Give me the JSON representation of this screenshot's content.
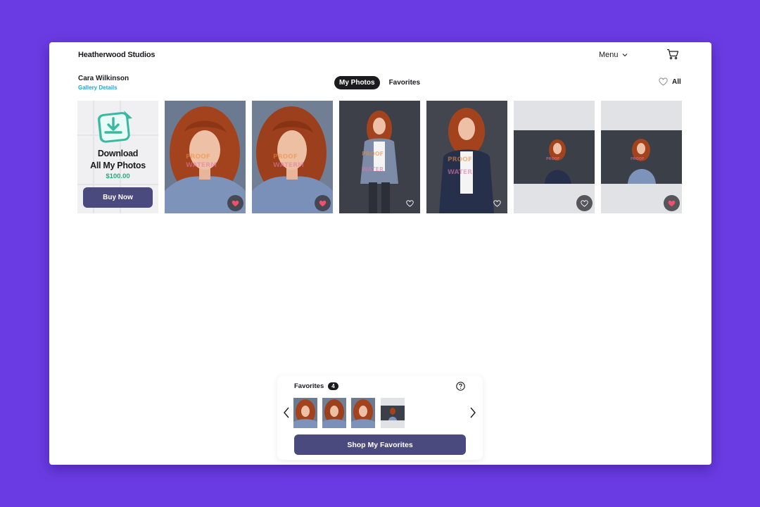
{
  "header": {
    "brand": "Heatherwood Studios",
    "menu_label": "Menu",
    "cart_icon": "cart-icon"
  },
  "subheader": {
    "user_name": "Cara Wilkinson",
    "gallery_link": "Gallery Details"
  },
  "tabs": [
    {
      "label": "My Photos",
      "active": true
    },
    {
      "label": "Favorites",
      "active": false
    }
  ],
  "filter": {
    "label": "All",
    "icon": "heart-outline-icon"
  },
  "promo": {
    "title_line1": "Download",
    "title_line2": "All My Photos",
    "price": "$100.00",
    "button": "Buy Now",
    "icon": "download-icon"
  },
  "photos": [
    {
      "style": "headshot",
      "favorited": true
    },
    {
      "style": "headshot",
      "favorited": true
    },
    {
      "style": "full-body",
      "favorited": false
    },
    {
      "style": "three-quarter",
      "favorited": false
    },
    {
      "style": "landscape-seated",
      "favorited": false
    },
    {
      "style": "landscape-portrait",
      "favorited": true
    }
  ],
  "favorites_panel": {
    "title": "Favorites",
    "count": "4",
    "help_icon": "help-icon",
    "thumbnails": [
      "headshot",
      "headshot",
      "headshot",
      "landscape"
    ],
    "button": "Shop My Favorites"
  },
  "colors": {
    "background": "#6a3be2",
    "primary_button": "#4a4a7e",
    "link": "#1aa7e0",
    "price": "#2aa77e",
    "favorite_heart": "#f0506e",
    "hair": "#a3431e",
    "shirt": "#7d93ba"
  }
}
